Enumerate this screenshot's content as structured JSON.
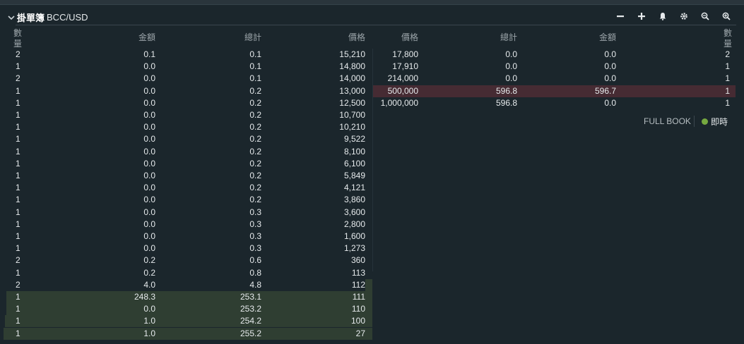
{
  "window": {
    "title": "掛單簿",
    "pair": "BCC/USD"
  },
  "toolbar": [
    "minus-icon",
    "plus-icon",
    "bell-icon",
    "gear-icon",
    "zoom-out-icon",
    "zoom-in-icon"
  ],
  "bids_header": {
    "count_1": "數",
    "count_2": "量",
    "amount": "金額",
    "total": "總計",
    "price": "價格"
  },
  "asks_header": {
    "price": "價格",
    "total": "總計",
    "amount": "金額",
    "count_1": "數",
    "count_2": "量"
  },
  "bids": [
    {
      "count": "2",
      "amount": "0.1",
      "total": "0.1",
      "price": "15,210"
    },
    {
      "count": "1",
      "amount": "0.0",
      "total": "0.1",
      "price": "14,800"
    },
    {
      "count": "2",
      "amount": "0.0",
      "total": "0.1",
      "price": "14,000"
    },
    {
      "count": "1",
      "amount": "0.0",
      "total": "0.2",
      "price": "13,000"
    },
    {
      "count": "1",
      "amount": "0.0",
      "total": "0.2",
      "price": "12,500"
    },
    {
      "count": "1",
      "amount": "0.0",
      "total": "0.2",
      "price": "10,700"
    },
    {
      "count": "1",
      "amount": "0.0",
      "total": "0.2",
      "price": "10,210"
    },
    {
      "count": "1",
      "amount": "0.0",
      "total": "0.2",
      "price": "9,522"
    },
    {
      "count": "1",
      "amount": "0.0",
      "total": "0.2",
      "price": "8,100"
    },
    {
      "count": "1",
      "amount": "0.0",
      "total": "0.2",
      "price": "6,100"
    },
    {
      "count": "1",
      "amount": "0.0",
      "total": "0.2",
      "price": "5,849"
    },
    {
      "count": "1",
      "amount": "0.0",
      "total": "0.2",
      "price": "4,121"
    },
    {
      "count": "1",
      "amount": "0.0",
      "total": "0.2",
      "price": "3,860"
    },
    {
      "count": "1",
      "amount": "0.0",
      "total": "0.3",
      "price": "3,600"
    },
    {
      "count": "1",
      "amount": "0.0",
      "total": "0.3",
      "price": "2,800"
    },
    {
      "count": "1",
      "amount": "0.0",
      "total": "0.3",
      "price": "1,600"
    },
    {
      "count": "1",
      "amount": "0.0",
      "total": "0.3",
      "price": "1,273"
    },
    {
      "count": "2",
      "amount": "0.2",
      "total": "0.6",
      "price": "360"
    },
    {
      "count": "1",
      "amount": "0.2",
      "total": "0.8",
      "price": "113"
    },
    {
      "count": "2",
      "amount": "4.0",
      "total": "4.8",
      "price": "112"
    },
    {
      "count": "1",
      "amount": "248.3",
      "total": "253.1",
      "price": "111"
    },
    {
      "count": "1",
      "amount": "0.0",
      "total": "253.2",
      "price": "110"
    },
    {
      "count": "1",
      "amount": "1.0",
      "total": "254.2",
      "price": "100"
    },
    {
      "count": "1",
      "amount": "1.0",
      "total": "255.2",
      "price": "27"
    }
  ],
  "asks": [
    {
      "price": "17,800",
      "total": "0.0",
      "amount": "0.0",
      "count": "2"
    },
    {
      "price": "17,910",
      "total": "0.0",
      "amount": "0.0",
      "count": "1"
    },
    {
      "price": "214,000",
      "total": "0.0",
      "amount": "0.0",
      "count": "1"
    },
    {
      "price": "500,000",
      "total": "596.8",
      "amount": "596.7",
      "count": "1"
    },
    {
      "price": "1,000,000",
      "total": "596.8",
      "amount": "0.0",
      "count": "1"
    }
  ],
  "footer": {
    "full_book": "FULL BOOK",
    "live": "即時"
  },
  "colors": {
    "bid_depth": "#2f3e32",
    "ask_depth": "#462b33",
    "live_dot": "#76a940"
  }
}
